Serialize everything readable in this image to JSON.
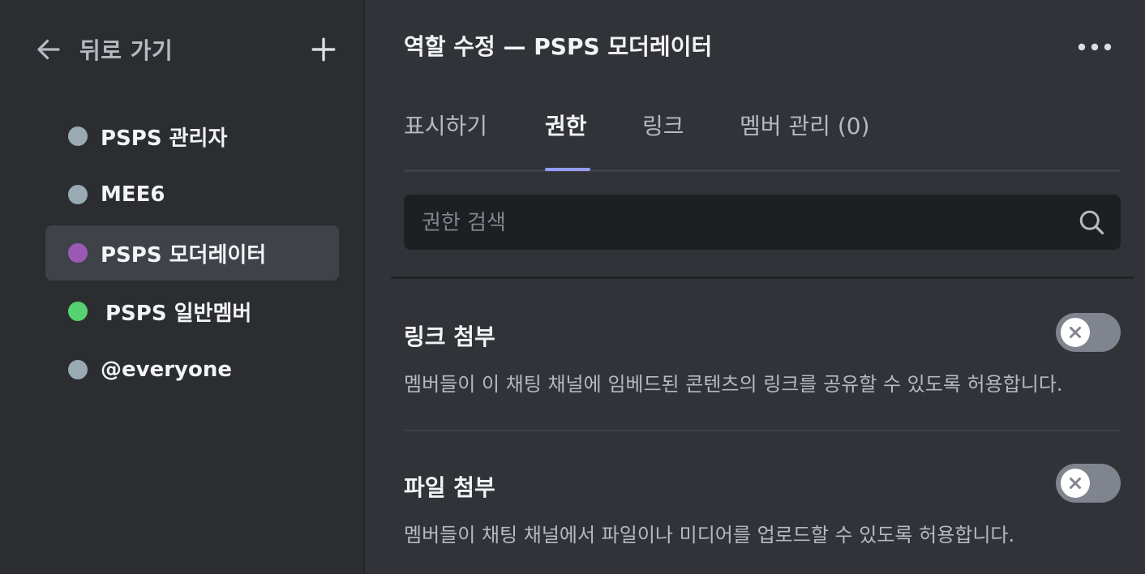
{
  "sidebar": {
    "back_label": "뒤로 가기",
    "add_role_icon": "plus-icon",
    "roles": [
      {
        "name": "PSPS 관리자",
        "color": "#99aab5",
        "selected": false
      },
      {
        "name": "MEE6",
        "color": "#99aab5",
        "selected": false
      },
      {
        "name": "PSPS 모더레이터",
        "color": "#9b59b6",
        "selected": true
      },
      {
        "name": "PSPS 일반멤버",
        "color": "#57d272",
        "selected": false
      },
      {
        "name": "@everyone",
        "color": "#99aab5",
        "selected": false
      }
    ]
  },
  "main": {
    "title": "역할 수정 — PSPS 모더레이터",
    "more_icon": "more-horizontal-icon",
    "tabs": [
      {
        "label": "표시하기",
        "active": false
      },
      {
        "label": "권한",
        "active": true
      },
      {
        "label": "링크",
        "active": false
      },
      {
        "label": "멤버 관리 (0)",
        "active": false
      }
    ],
    "search": {
      "placeholder": "권한 검색",
      "value": ""
    },
    "permissions": [
      {
        "title": "링크 첨부",
        "description": "멤버들이 이 채팅 채널에 임베드된 콘텐츠의 링크를 공유할 수 있도록 허용합니다.",
        "enabled": false
      },
      {
        "title": "파일 첨부",
        "description": "멤버들이 채팅 채널에서 파일이나 미디어를 업로드할 수 있도록 허용합니다.",
        "enabled": false
      }
    ]
  },
  "colors": {
    "accent": "#949cf7",
    "background": "#313338",
    "sidebar": "#2b2d31",
    "toggle_off": "#80848e"
  }
}
